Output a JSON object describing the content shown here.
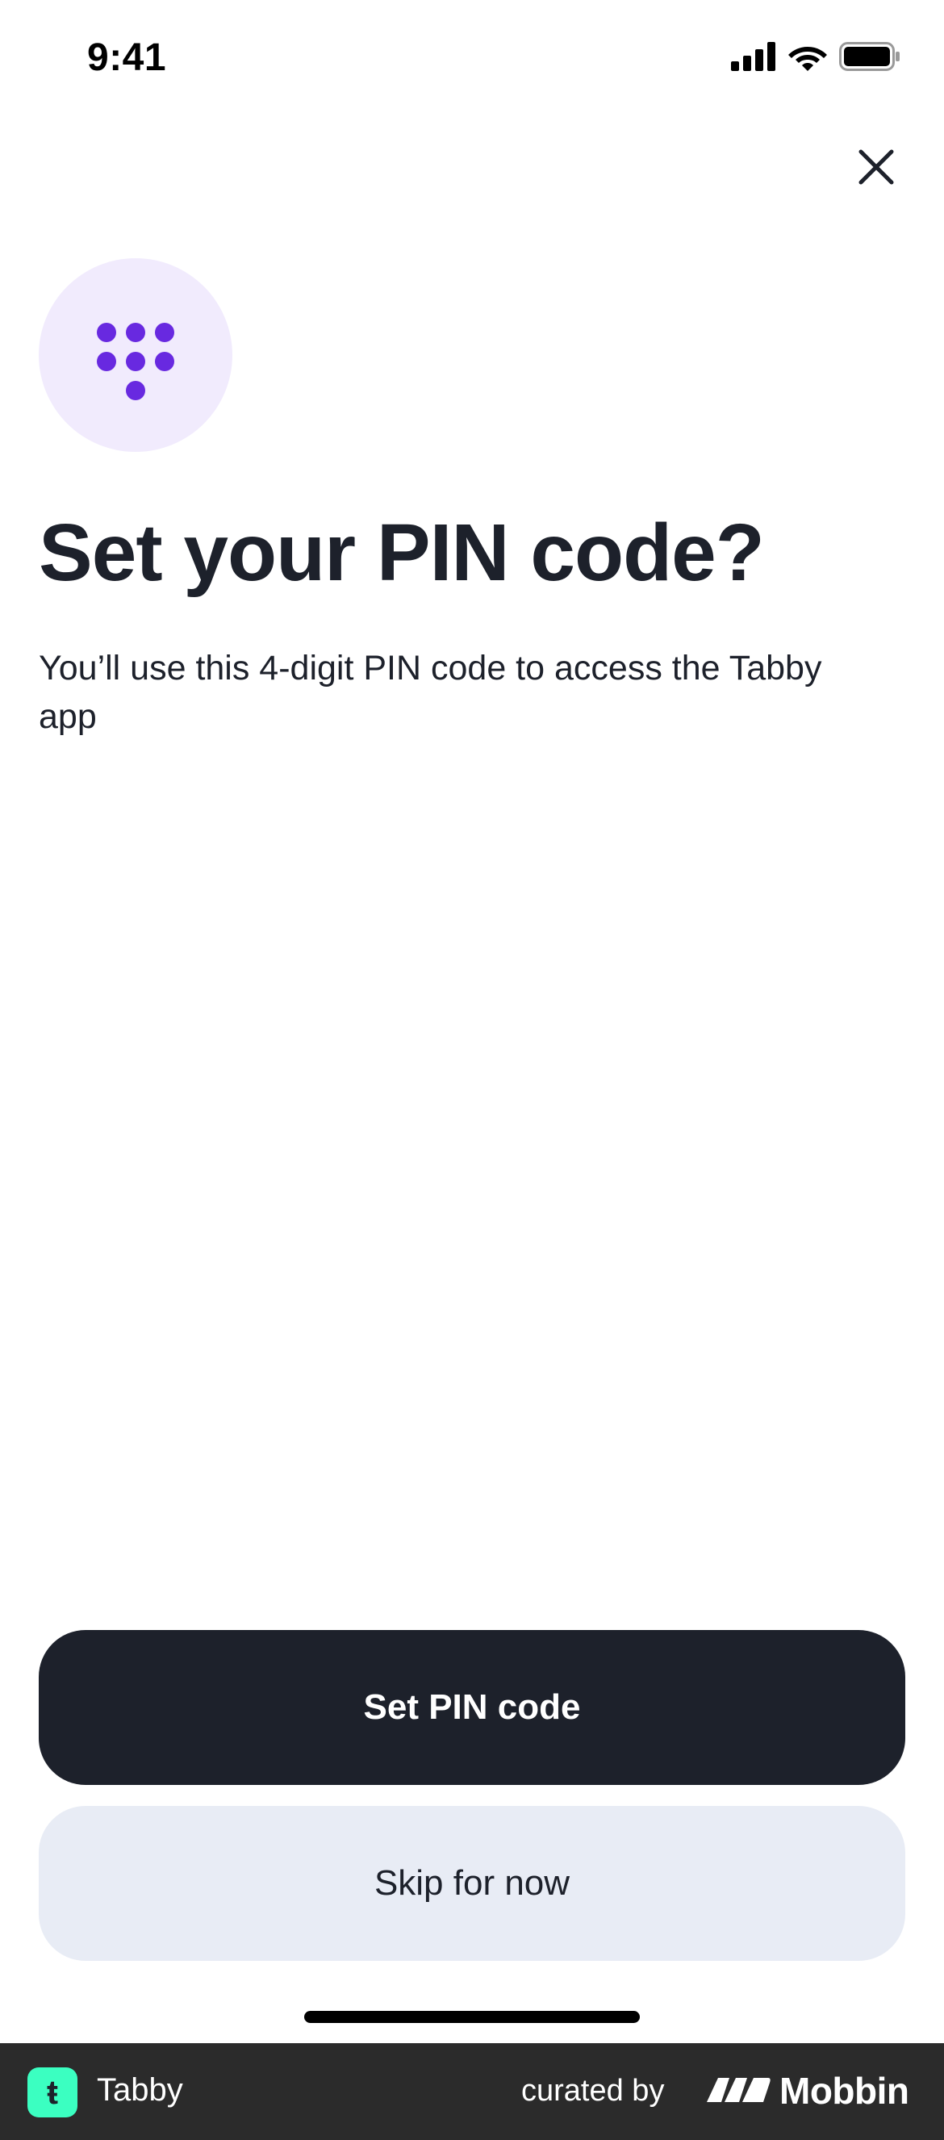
{
  "status_bar": {
    "time": "9:41"
  },
  "icons": {
    "close": "close-icon",
    "keypad": "keypad-icon",
    "signal": "cellular-signal-icon",
    "wifi": "wifi-icon",
    "battery": "battery-icon"
  },
  "content": {
    "title": "Set your PIN code?",
    "subtitle": "You’ll use this 4-digit PIN code to access the Tabby app"
  },
  "actions": {
    "primary_label": "Set PIN code",
    "secondary_label": "Skip for now"
  },
  "footer": {
    "app_logo_glyph": "ŧ",
    "app_name": "Tabby",
    "curated_by": "curated by",
    "brand": "Mobbin"
  },
  "colors": {
    "primary_button": "#1d212b",
    "secondary_button": "#e8ecf5",
    "badge_background": "#f1ebfd",
    "badge_dots": "#6829e0",
    "app_logo": "#3bffc1",
    "footer_background": "#2b2b2b"
  }
}
